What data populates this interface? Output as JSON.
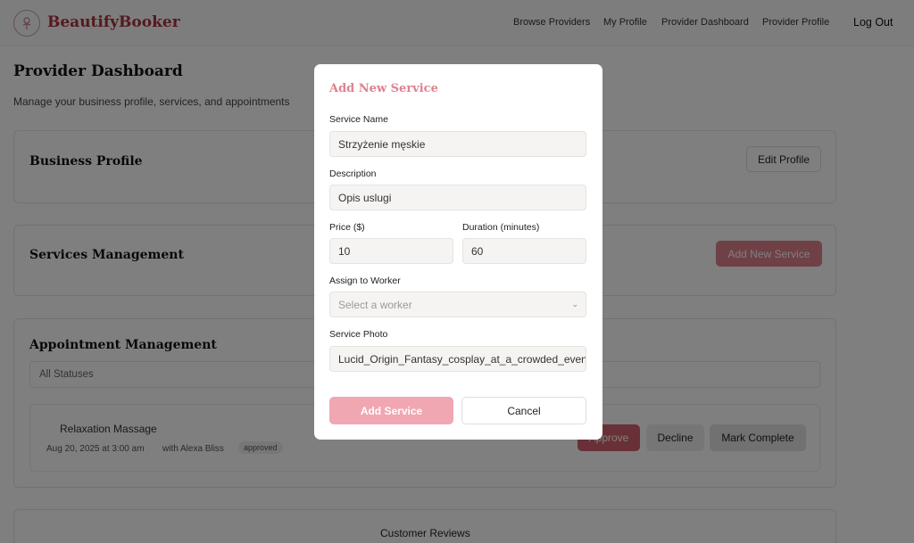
{
  "header": {
    "brand": "BeautifyBooker",
    "logo_icon": "flower-logo-icon",
    "nav": [
      "Browse Providers",
      "My Profile",
      "Provider Dashboard",
      "Provider Profile"
    ],
    "logout": "Log Out"
  },
  "page": {
    "title": "Provider Dashboard",
    "subtitle": "Manage your business profile, services, and appointments"
  },
  "business_profile": {
    "title": "Business Profile",
    "edit_button": "Edit Profile"
  },
  "services": {
    "title": "Services Management",
    "add_button": "Add New Service"
  },
  "appointments": {
    "title": "Appointment Management",
    "filter": "All Statuses",
    "items": [
      {
        "service": "Relaxation Massage",
        "date": "Aug 20, 2025 at 3:00 am",
        "worker": "with Alexa Bliss",
        "status": "approved",
        "approve": "Approve",
        "decline": "Decline",
        "complete": "Mark Complete"
      }
    ]
  },
  "reviews": {
    "title": "Customer Reviews"
  },
  "modal": {
    "title": "Add New Service",
    "name_label": "Service Name",
    "name_value": "Strzyżenie męskie",
    "desc_label": "Description",
    "desc_value": "Opis uslugi",
    "price_label": "Price ($)",
    "price_value": "10",
    "duration_label": "Duration (minutes)",
    "duration_value": "60",
    "worker_label": "Assign to Worker",
    "worker_placeholder": "Select a worker",
    "photo_label": "Service Photo",
    "photo_value": "Lucid_Origin_Fantasy_cosplay_at_a_crowded_event",
    "submit": "Add Service",
    "cancel": "Cancel"
  },
  "colors": {
    "accent": "#e0818f",
    "brand": "#a8323f",
    "overlay": "rgba(0,0,0,0.5)"
  }
}
